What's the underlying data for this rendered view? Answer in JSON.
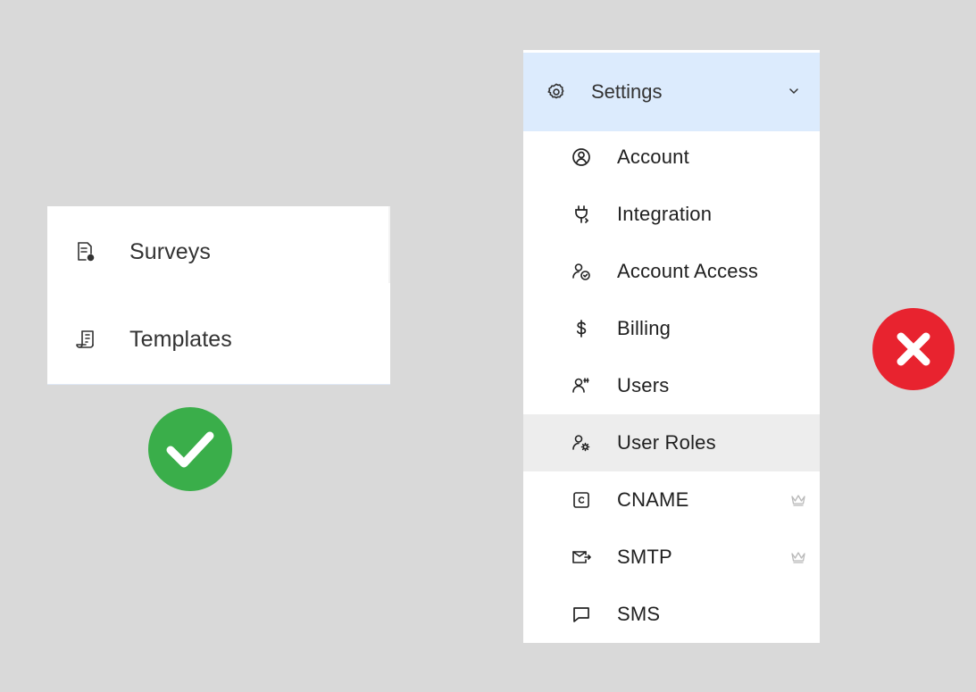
{
  "left_menu": {
    "items": [
      {
        "label": "Surveys",
        "icon": "survey-document-icon"
      },
      {
        "label": "Templates",
        "icon": "templates-scroll-icon"
      }
    ]
  },
  "settings_menu": {
    "header": {
      "label": "Settings",
      "icon": "gear-icon",
      "chevron": "chevron-down-icon"
    },
    "items": [
      {
        "label": "Account",
        "icon": "account-circle-icon",
        "premium": false,
        "active": false
      },
      {
        "label": "Integration",
        "icon": "plug-icon",
        "premium": false,
        "active": false
      },
      {
        "label": "Account Access",
        "icon": "user-access-icon",
        "premium": false,
        "active": false
      },
      {
        "label": "Billing",
        "icon": "dollar-icon",
        "premium": false,
        "active": false
      },
      {
        "label": "Users",
        "icon": "users-icon",
        "premium": false,
        "active": false
      },
      {
        "label": "User Roles",
        "icon": "user-gear-icon",
        "premium": false,
        "active": true
      },
      {
        "label": "CNAME",
        "icon": "cname-c-icon",
        "premium": true,
        "active": false
      },
      {
        "label": "SMTP",
        "icon": "mail-send-icon",
        "premium": true,
        "active": false
      },
      {
        "label": "SMS",
        "icon": "chat-bubble-icon",
        "premium": false,
        "active": false
      }
    ]
  },
  "badges": {
    "approved": {
      "icon": "checkmark-icon",
      "color": "#3aae4a"
    },
    "rejected": {
      "icon": "cross-icon",
      "color": "#e8232f"
    }
  },
  "colors": {
    "background": "#d9d9d9",
    "header_highlight": "#dcebfd",
    "active_row": "#ededed"
  }
}
